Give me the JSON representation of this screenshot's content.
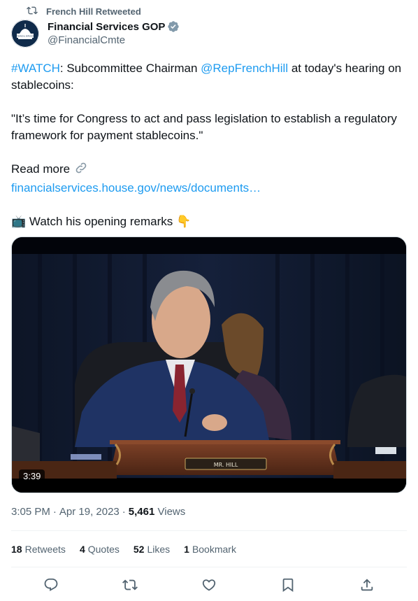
{
  "retweet": {
    "text": "French Hill Retweeted",
    "icon": "retweet-icon"
  },
  "author": {
    "name": "Financial Services GOP",
    "handle": "@FinancialCmte",
    "verified": true,
    "avatar_label": "FINANCIAL SERVICES COMMITTEE"
  },
  "tweet": {
    "hashtag": "#WATCH",
    "line1_a": ": Subcommittee Chairman ",
    "mention": "@RepFrenchHill",
    "line1_b": " at today's hearing on stablecoins:",
    "quote": "\"It’s time for Congress to act and pass legislation to establish a regulatory framework for payment stablecoins.\"",
    "read_more": "Read more",
    "link_icon": "link-icon",
    "url": "financialservices.house.gov/news/documents…",
    "watch_emoji": "📺",
    "watch_text": "Watch his opening remarks",
    "pointing_emoji": "👇"
  },
  "media": {
    "duration": "3:39",
    "nameplate": "MR. HILL"
  },
  "meta": {
    "time": "3:05 PM",
    "sep1": "·",
    "date": "Apr 19, 2023",
    "sep2": "·",
    "views_count": "5,461",
    "views_label": "Views"
  },
  "stats": [
    {
      "count": "18",
      "label": "Retweets"
    },
    {
      "count": "4",
      "label": "Quotes"
    },
    {
      "count": "52",
      "label": "Likes"
    },
    {
      "count": "1",
      "label": "Bookmark"
    }
  ],
  "actions": [
    "reply-icon",
    "retweet-icon",
    "like-icon",
    "bookmark-icon",
    "share-icon"
  ],
  "colors": {
    "link": "#1d9bf0",
    "secondary_text": "#536471",
    "primary_text": "#0f1419",
    "verified_badge": "#829aab"
  }
}
